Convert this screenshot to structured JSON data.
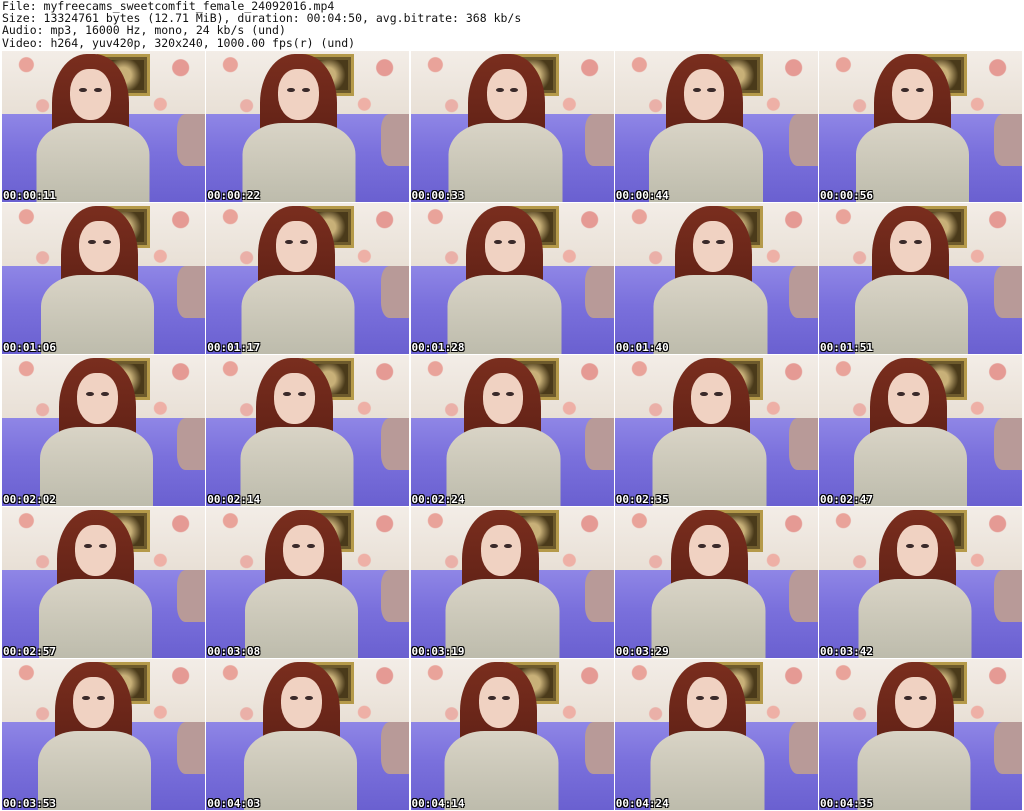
{
  "header": {
    "file": "File: myfreecams_sweetcomfit_female_24092016.mp4",
    "size": "Size: 13324761 bytes (12.71 MiB), duration: 00:04:50, avg.bitrate: 368 kb/s",
    "audio": "Audio: mp3, 16000 Hz, mono, 24 kb/s (und)",
    "video": "Video: h264, yuv420p, 320x240, 1000.00 fps(r) (und)"
  },
  "thumbnails": [
    {
      "timestamp": "00:00:11"
    },
    {
      "timestamp": "00:00:22"
    },
    {
      "timestamp": "00:00:33"
    },
    {
      "timestamp": "00:00:44"
    },
    {
      "timestamp": "00:00:56"
    },
    {
      "timestamp": "00:01:06"
    },
    {
      "timestamp": "00:01:17"
    },
    {
      "timestamp": "00:01:28"
    },
    {
      "timestamp": "00:01:40"
    },
    {
      "timestamp": "00:01:51"
    },
    {
      "timestamp": "00:02:02"
    },
    {
      "timestamp": "00:02:14"
    },
    {
      "timestamp": "00:02:24"
    },
    {
      "timestamp": "00:02:35"
    },
    {
      "timestamp": "00:02:47"
    },
    {
      "timestamp": "00:02:57"
    },
    {
      "timestamp": "00:03:08"
    },
    {
      "timestamp": "00:03:19"
    },
    {
      "timestamp": "00:03:29"
    },
    {
      "timestamp": "00:03:42"
    },
    {
      "timestamp": "00:03:53"
    },
    {
      "timestamp": "00:04:03"
    },
    {
      "timestamp": "00:04:14"
    },
    {
      "timestamp": "00:04:24"
    },
    {
      "timestamp": "00:04:35"
    }
  ]
}
